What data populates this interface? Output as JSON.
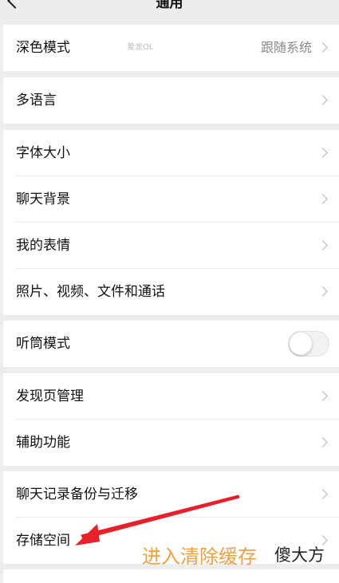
{
  "nav": {
    "title": "通用"
  },
  "groups": {
    "dark_mode": {
      "label": "深色模式",
      "value": "跟随系统",
      "watermark": "爱龙OL"
    },
    "language": {
      "label": "多语言"
    },
    "display": {
      "font_size": "字体大小",
      "chat_background": "聊天背景",
      "my_stickers": "我的表情",
      "media": "照片、视频、文件和通话"
    },
    "earpiece": {
      "label": "听筒模式",
      "enabled": false
    },
    "discover": {
      "discover_manage": "发现页管理",
      "accessibility": "辅助功能"
    },
    "storage": {
      "chat_backup": "聊天记录备份与迁移",
      "storage_space": "存储空间"
    }
  },
  "annotation": {
    "text": "进入清除缓存",
    "overlay_text": "傻大方",
    "arrow_color": "#e8202a"
  }
}
